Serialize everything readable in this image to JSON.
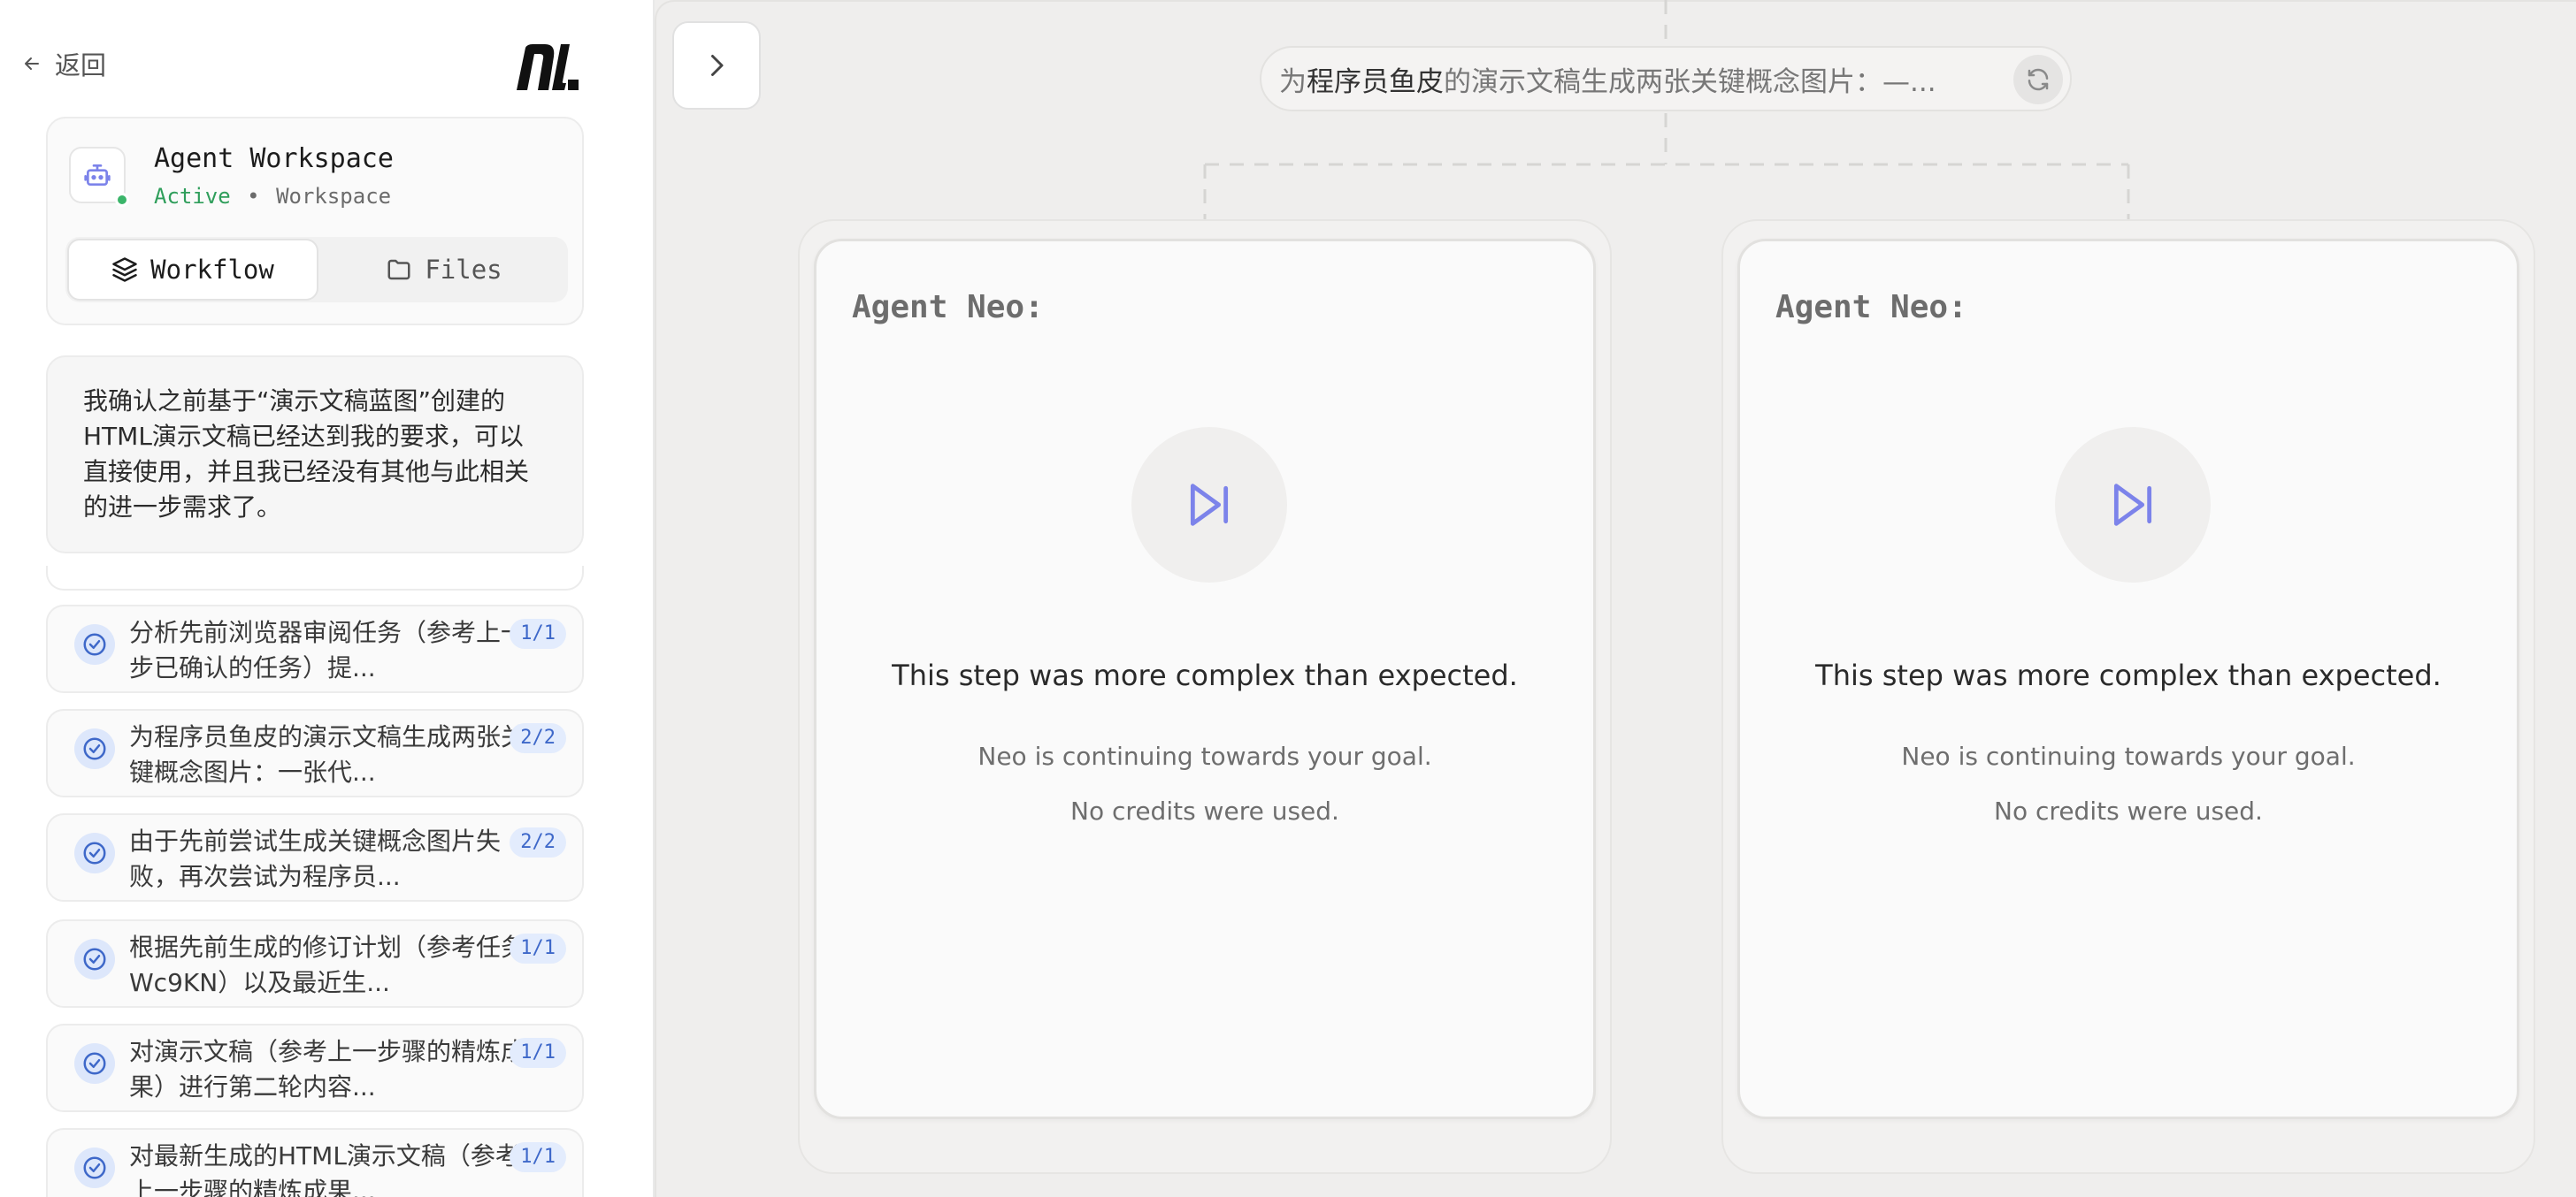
{
  "sidebar": {
    "back_label": "返回",
    "workspace": {
      "title": "Agent Workspace",
      "status": "Active",
      "separator": "•",
      "type": "Workspace",
      "avatar_icon": "robot-icon"
    },
    "tabs": [
      {
        "label": "Workflow",
        "icon": "layers-icon",
        "active": true
      },
      {
        "label": "Files",
        "icon": "folder-icon",
        "active": false
      }
    ],
    "user_message": "我确认之前基于“演示文稿蓝图”创建的HTML演示文稿已经达到我的要求，可以直接使用，并且我已经没有其他与此相关的进一步需求了。",
    "tasks": [
      {
        "text": "分析先前浏览器审阅任务（参考上一步已确认的任务）提...",
        "badge": "1/1"
      },
      {
        "text": "为程序员鱼皮的演示文稿生成两张关键概念图片：一张代...",
        "badge": "2/2"
      },
      {
        "text": "由于先前尝试生成关键概念图片失败，再次尝试为程序员...",
        "badge": "2/2"
      },
      {
        "text": "根据先前生成的修订计划（参考任务 Wc9KN）以及最近生...",
        "badge": "1/1"
      },
      {
        "text": "对演示文稿（参考上一步骤的精炼成果）进行第二轮内容...",
        "badge": "1/1"
      },
      {
        "text": "对最新生成的HTML演示文稿（参考上一步骤的精炼成果...",
        "badge": "1/1"
      }
    ]
  },
  "main": {
    "prompt": {
      "prefix": "为",
      "highlight": "程序员鱼皮",
      "rest": "的演示文稿生成两张关键概念图片：—..."
    },
    "agents": [
      {
        "name": "Agent Neo:",
        "heading": "This step was more complex than expected.",
        "line1": "Neo is continuing towards your goal.",
        "line2": "No credits were used."
      },
      {
        "name": "Agent Neo:",
        "heading": "This step was more complex than expected.",
        "line1": "Neo is continuing towards your goal.",
        "line2": "No credits were used."
      }
    ]
  },
  "colors": {
    "accent": "#7c83ea",
    "status_active": "#2f9e5b",
    "badge_text": "#3e68c9",
    "main_bg": "#efeeed"
  }
}
